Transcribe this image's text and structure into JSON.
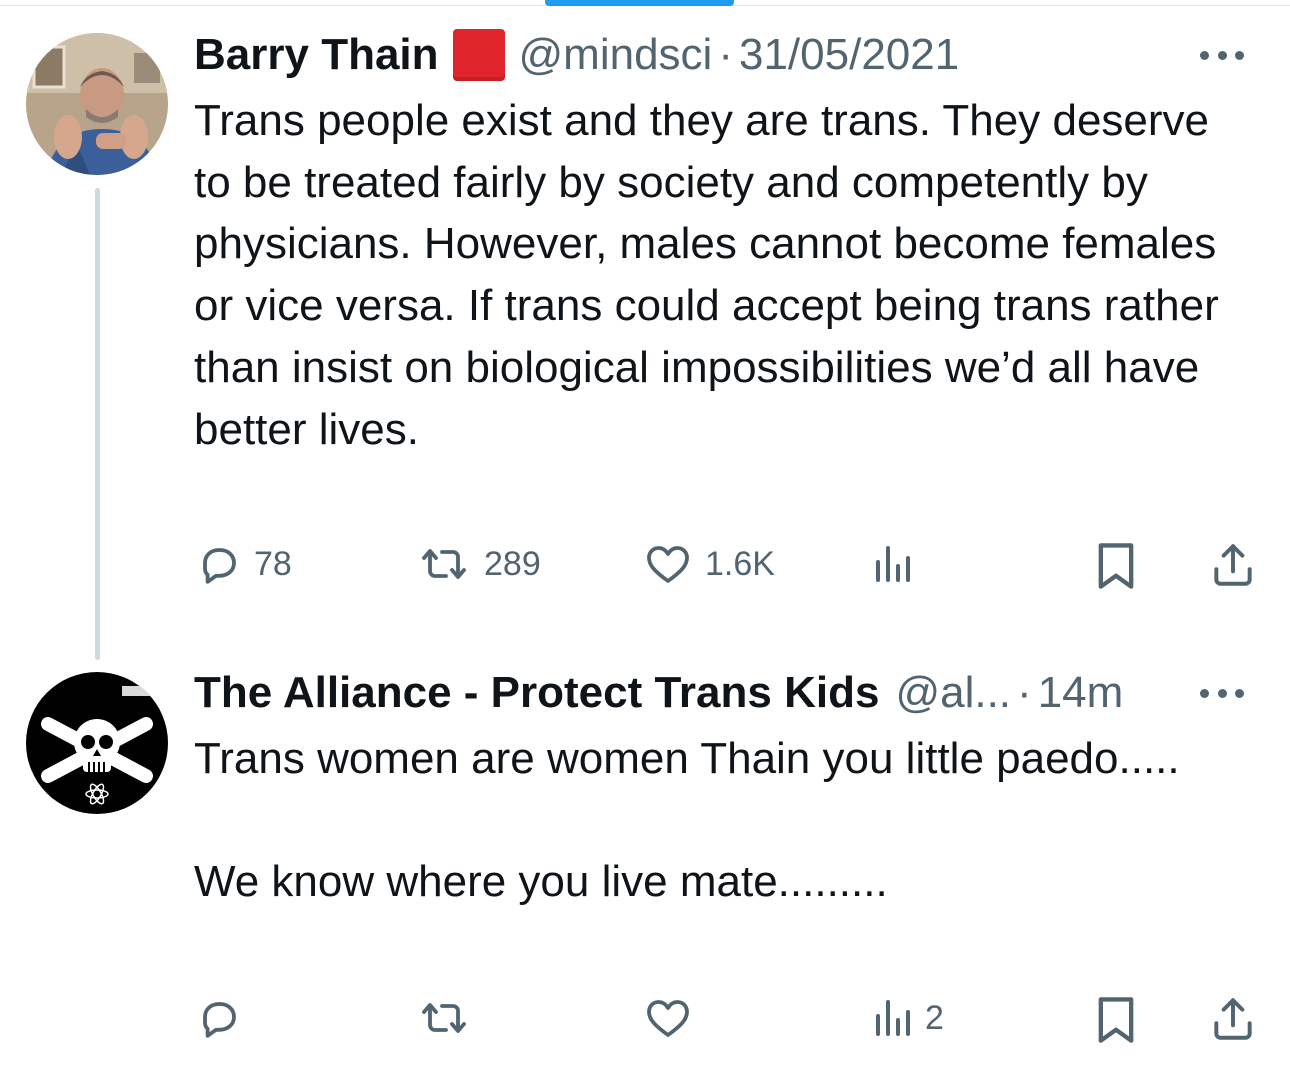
{
  "tweets": [
    {
      "author": {
        "name": "Barry Thain",
        "handle": "@mindsci",
        "flag_emoji": "red-square"
      },
      "separator": "·",
      "timestamp": "31/05/2021",
      "text": "Trans people exist and they are trans. They deserve to be treated fairly by society and competently by physicians. However, males cannot become females or vice versa. If trans could accept being trans rather than insist on biological impossibilities we’d all have better lives.",
      "actions": {
        "replies": "78",
        "reposts": "289",
        "likes": "1.6K",
        "views": ""
      }
    },
    {
      "author": {
        "name": "The Alliance - Protect Trans Kids",
        "handle": "@al...",
        "avatar_icon": "skull-crossbones-icon"
      },
      "separator": "·",
      "timestamp": "14m",
      "text": "Trans women are women Thain you little paedo.....\n\nWe know where you live mate.........",
      "actions": {
        "replies": "",
        "reposts": "",
        "likes": "",
        "views": "2"
      }
    }
  ],
  "colors": {
    "text": "#0f1419",
    "secondary": "#536471",
    "accent": "#1d9bf0",
    "thread_line": "#cfd9de",
    "flag": "#e0242c"
  },
  "icons": [
    "reply-icon",
    "repost-icon",
    "like-icon",
    "views-icon",
    "bookmark-icon",
    "share-icon",
    "more-icon"
  ]
}
